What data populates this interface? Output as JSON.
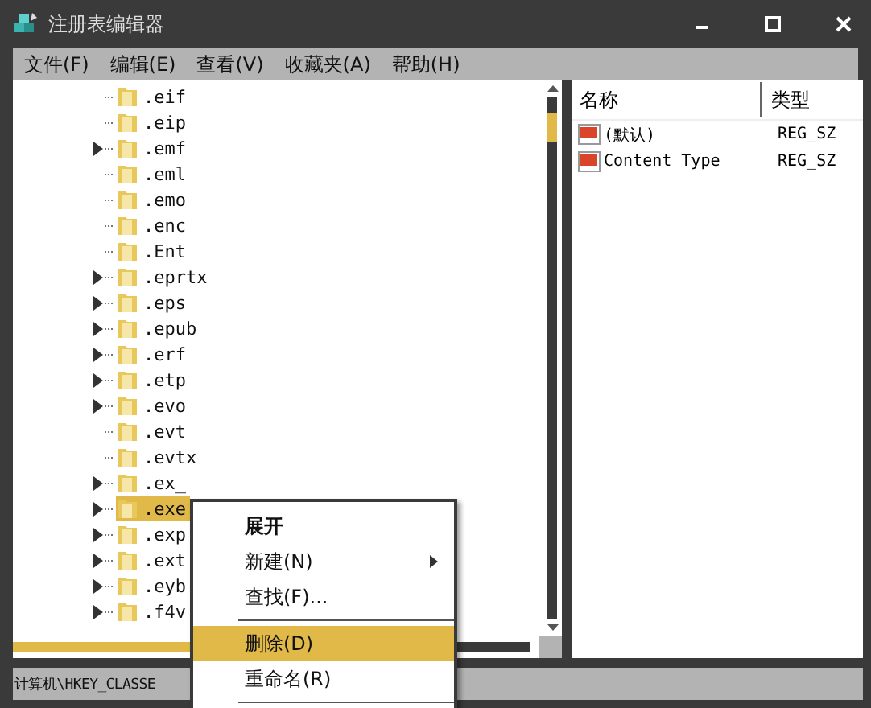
{
  "window": {
    "title": "注册表编辑器"
  },
  "menu": [
    "文件(F)",
    "编辑(E)",
    "查看(V)",
    "收藏夹(A)",
    "帮助(H)"
  ],
  "tree": [
    {
      "label": ".eif",
      "expandable": false,
      "selected": false
    },
    {
      "label": ".eip",
      "expandable": false,
      "selected": false
    },
    {
      "label": ".emf",
      "expandable": true,
      "selected": false
    },
    {
      "label": ".eml",
      "expandable": false,
      "selected": false
    },
    {
      "label": ".emo",
      "expandable": false,
      "selected": false
    },
    {
      "label": ".enc",
      "expandable": false,
      "selected": false
    },
    {
      "label": ".Ent",
      "expandable": false,
      "selected": false
    },
    {
      "label": ".eprtx",
      "expandable": true,
      "selected": false
    },
    {
      "label": ".eps",
      "expandable": true,
      "selected": false
    },
    {
      "label": ".epub",
      "expandable": true,
      "selected": false
    },
    {
      "label": ".erf",
      "expandable": true,
      "selected": false
    },
    {
      "label": ".etp",
      "expandable": true,
      "selected": false
    },
    {
      "label": ".evo",
      "expandable": true,
      "selected": false
    },
    {
      "label": ".evt",
      "expandable": false,
      "selected": false
    },
    {
      "label": ".evtx",
      "expandable": false,
      "selected": false
    },
    {
      "label": ".ex_",
      "expandable": true,
      "selected": false
    },
    {
      "label": ".exe",
      "expandable": true,
      "selected": true
    },
    {
      "label": ".exp",
      "expandable": true,
      "selected": false
    },
    {
      "label": ".ext",
      "expandable": true,
      "selected": false
    },
    {
      "label": ".eyb",
      "expandable": true,
      "selected": false
    },
    {
      "label": ".f4v",
      "expandable": true,
      "selected": false
    }
  ],
  "values": {
    "columns": [
      "名称",
      "类型"
    ],
    "rows": [
      {
        "name": "(默认)",
        "type": "REG_SZ"
      },
      {
        "name": "Content Type",
        "type": "REG_SZ"
      }
    ]
  },
  "status_bar": "计算机\\HKEY_CLASSE",
  "context_menu": [
    {
      "kind": "item",
      "label": "展开",
      "bold": true,
      "submenu": false,
      "selected": false
    },
    {
      "kind": "item",
      "label": "新建(N)",
      "bold": false,
      "submenu": true,
      "selected": false
    },
    {
      "kind": "item",
      "label": "查找(F)...",
      "bold": false,
      "submenu": false,
      "selected": false
    },
    {
      "kind": "separator"
    },
    {
      "kind": "item",
      "label": "删除(D)",
      "bold": false,
      "submenu": false,
      "selected": true
    },
    {
      "kind": "item",
      "label": "重命名(R)",
      "bold": false,
      "submenu": false,
      "selected": false
    },
    {
      "kind": "separator"
    }
  ]
}
